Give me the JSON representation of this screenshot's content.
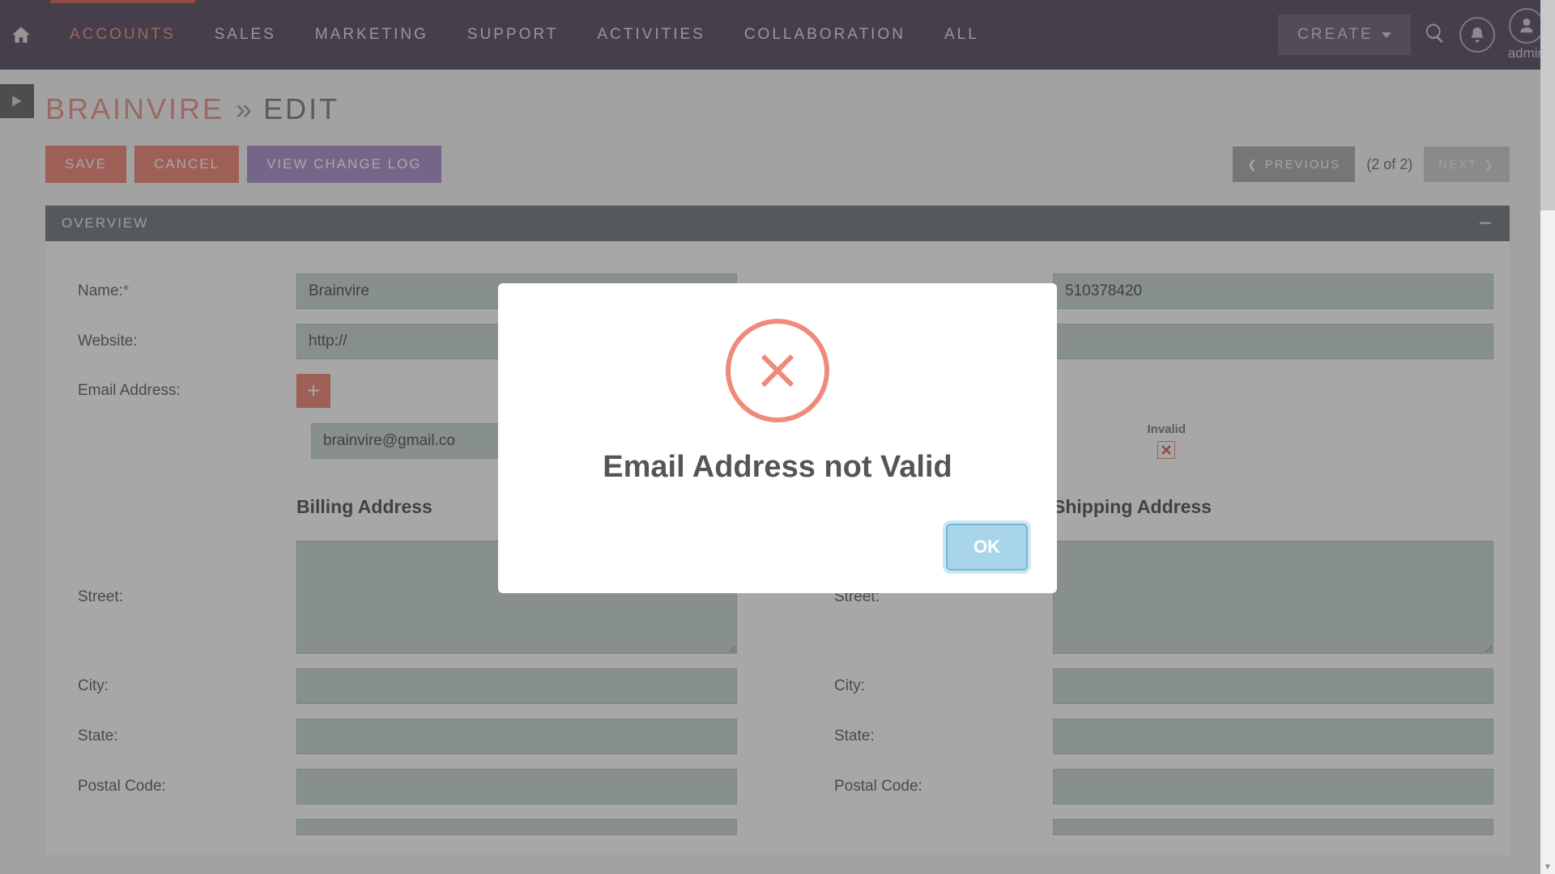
{
  "nav": {
    "items": [
      "ACCOUNTS",
      "SALES",
      "MARKETING",
      "SUPPORT",
      "ACTIVITIES",
      "COLLABORATION",
      "ALL"
    ],
    "activeIndex": 0,
    "create": "CREATE",
    "user": "admin"
  },
  "page": {
    "title": "BRAINVIRE",
    "sep": "»",
    "subtitle": "EDIT"
  },
  "actions": {
    "save": "SAVE",
    "cancel": "CANCEL",
    "viewlog": "VIEW CHANGE LOG",
    "previous": "PREVIOUS",
    "next": "NEXT",
    "pager": "(2 of 2)"
  },
  "section": {
    "title": "OVERVIEW"
  },
  "form": {
    "name_label": "Name:",
    "name_value": "Brainvire",
    "phone_value": "510378420",
    "website_label": "Website:",
    "website_value": "http://",
    "email_label": "Email Address:",
    "email_value": "brainvire@gmail.co",
    "invalid_label": "Invalid",
    "billing_heading": "Billing Address",
    "shipping_heading": "Shipping Address",
    "street_label": "Street:",
    "city_label": "City:",
    "state_label": "State:",
    "postal_label": "Postal Code:"
  },
  "modal": {
    "title": "Email Address not Valid",
    "ok": "OK"
  }
}
